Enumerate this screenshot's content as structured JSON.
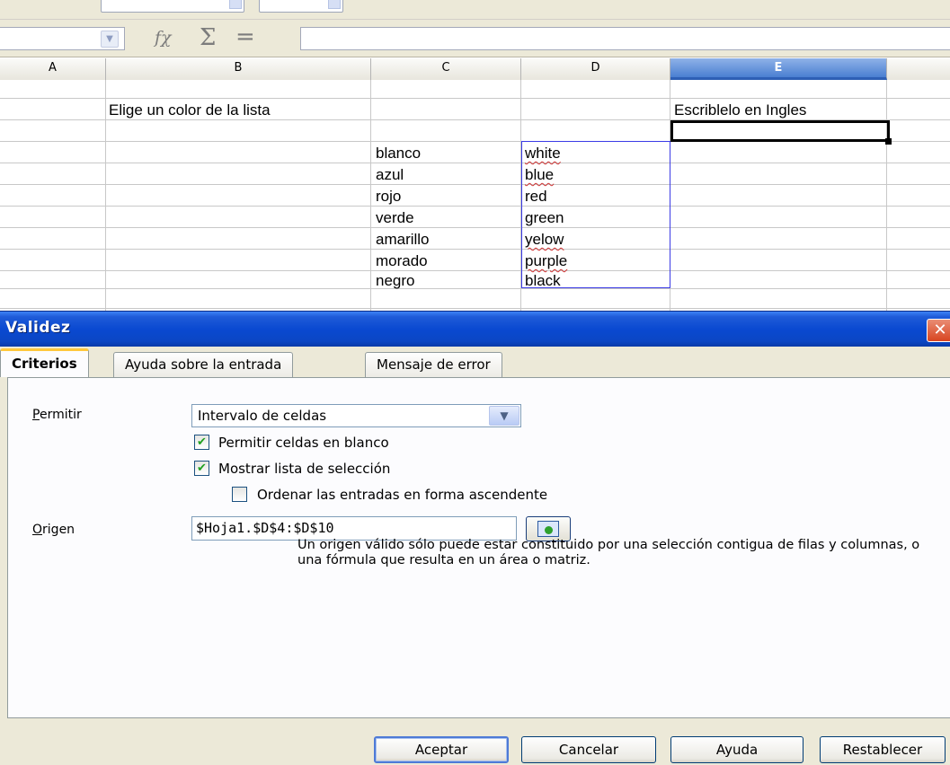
{
  "formula_bar": {
    "fx_symbol": "fχ",
    "sum_symbol": "Σ",
    "equals_symbol": "=",
    "formula_value": ""
  },
  "sheet": {
    "columns": [
      "A",
      "B",
      "C",
      "D",
      "E"
    ],
    "selected_column": "E",
    "prompt": "Elige un color de la lista",
    "instruction": "Escriblelo en Ingles",
    "spanish_colors": [
      "blanco",
      "azul",
      "rojo",
      "verde",
      "amarillo",
      "morado",
      "negro"
    ],
    "english_colors": [
      "white",
      "blue",
      "red",
      "green",
      "yelow",
      "purple",
      "black"
    ]
  },
  "dialog": {
    "title": "Validez",
    "close_glyph": "✕",
    "tabs": [
      {
        "label": "Criterios",
        "active": true
      },
      {
        "label": "Ayuda sobre la entrada",
        "active": false
      },
      {
        "label": "Mensaje de error",
        "active": false
      }
    ],
    "allow_label": "Permitir",
    "allow_value": "Intervalo de celdas",
    "allow_blank_label": "Permitir celdas en blanco",
    "allow_blank_checked": true,
    "show_list_label": "Mostrar lista de selección",
    "show_list_checked": true,
    "sort_label": "Ordenar las entradas en forma ascendente",
    "sort_checked": false,
    "source_label": "Origen",
    "source_value": "$Hoja1.$D$4:$D$10",
    "source_help": "Un origen válido sólo puede estar constituido por una selección contigua de filas y columnas, o una fórmula que resulta en un área o matriz.",
    "buttons": {
      "accept": "Aceptar",
      "cancel": "Cancelar",
      "help": "Ayuda",
      "reset": "Restablecer"
    }
  }
}
